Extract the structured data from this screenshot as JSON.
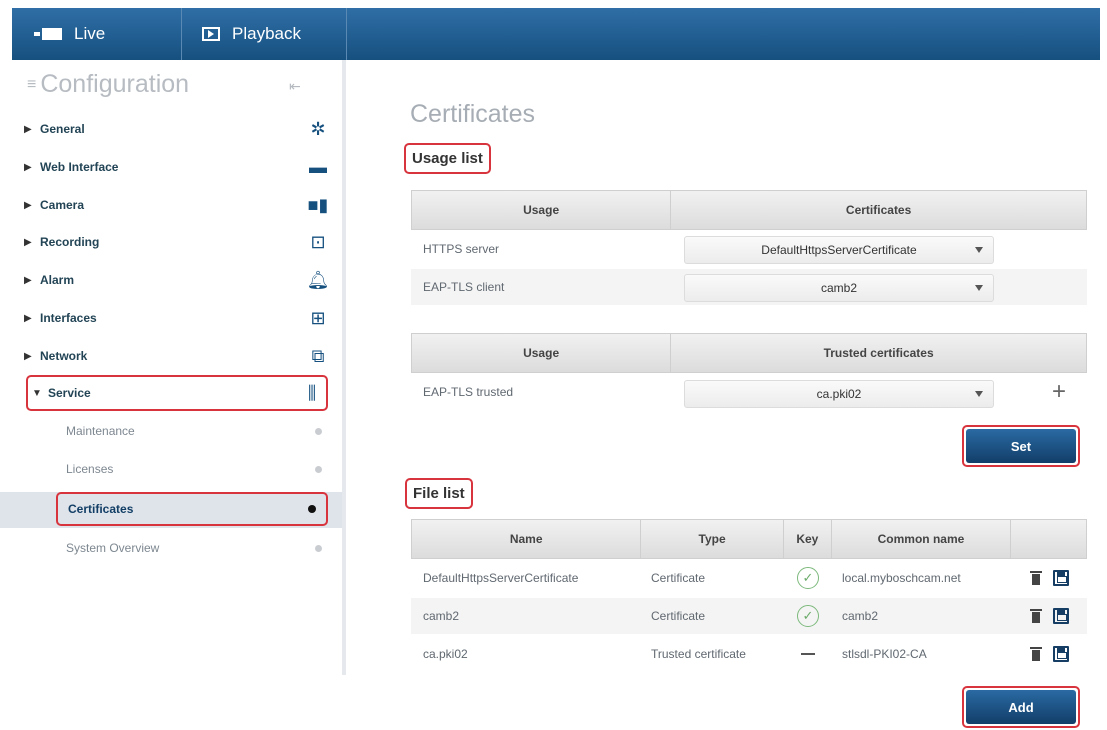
{
  "topbar": {
    "live_label": "Live",
    "playback_label": "Playback"
  },
  "sidebar": {
    "title": "Configuration",
    "items": [
      {
        "label": "General",
        "icon": "gear-icon",
        "expanded": false
      },
      {
        "label": "Web Interface",
        "icon": "web-interface-icon",
        "expanded": false
      },
      {
        "label": "Camera",
        "icon": "camera-icon",
        "expanded": false
      },
      {
        "label": "Recording",
        "icon": "recording-icon",
        "expanded": false
      },
      {
        "label": "Alarm",
        "icon": "bell-icon",
        "expanded": false
      },
      {
        "label": "Interfaces",
        "icon": "interfaces-icon",
        "expanded": false
      },
      {
        "label": "Network",
        "icon": "network-icon",
        "expanded": false
      },
      {
        "label": "Service",
        "icon": "service-icon",
        "expanded": true
      }
    ],
    "sub_items": [
      {
        "label": "Maintenance"
      },
      {
        "label": "Licenses"
      },
      {
        "label": "Certificates",
        "active": true
      },
      {
        "label": "System Overview"
      }
    ]
  },
  "main": {
    "page_title": "Certificates",
    "usage_list": {
      "heading": "Usage list",
      "table1": {
        "headers": [
          "Usage",
          "Certificates"
        ],
        "rows": [
          {
            "usage": "HTTPS server",
            "value": "DefaultHttpsServerCertificate"
          },
          {
            "usage": "EAP-TLS client",
            "value": "camb2"
          }
        ]
      },
      "table2": {
        "headers": [
          "Usage",
          "Trusted certificates"
        ],
        "rows": [
          {
            "usage": "EAP-TLS trusted",
            "value": "ca.pki02"
          }
        ]
      },
      "set_button": "Set"
    },
    "file_list": {
      "heading": "File list",
      "headers": [
        "Name",
        "Type",
        "Key",
        "Common name",
        ""
      ],
      "rows": [
        {
          "name": "DefaultHttpsServerCertificate",
          "type": "Certificate",
          "key": "check",
          "common_name": "local.myboschcam.net"
        },
        {
          "name": "camb2",
          "type": "Certificate",
          "key": "check",
          "common_name": "camb2"
        },
        {
          "name": "ca.pki02",
          "type": "Trusted certificate",
          "key": "none",
          "common_name": "stlsdl-PKI02-CA"
        }
      ],
      "add_button": "Add"
    }
  },
  "colors": {
    "accent": "#16507f",
    "highlight": "#d8343e"
  }
}
